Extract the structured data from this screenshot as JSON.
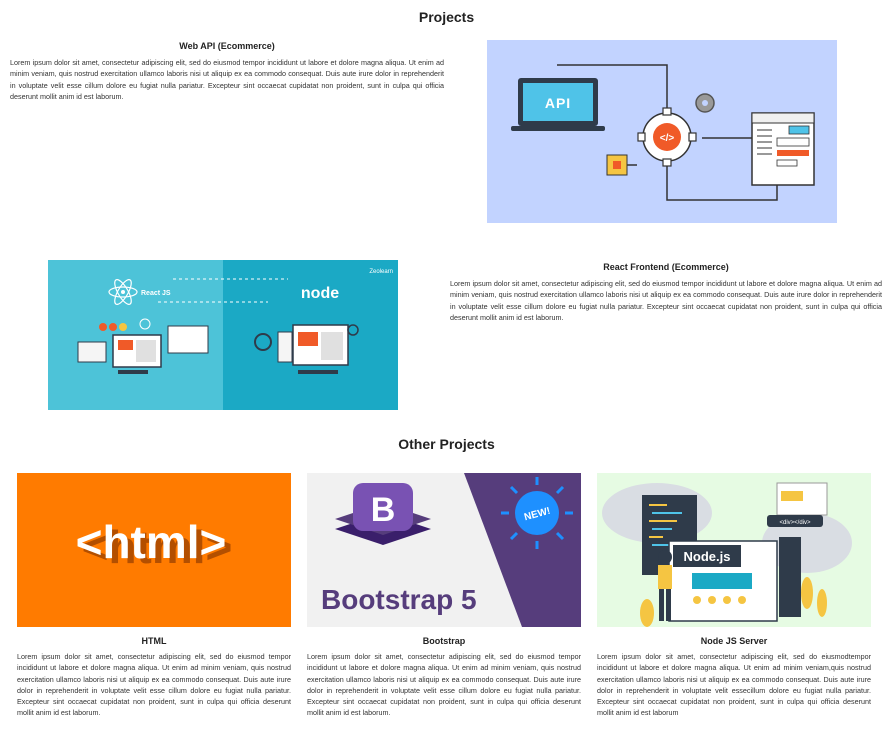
{
  "projects_section": {
    "title": "Projects",
    "items": [
      {
        "title": "Web API (Ecommerce)",
        "description": "Lorem ipsum dolor sit amet, consectetur adipiscing elit, sed do eiusmod tempor incididunt ut labore et dolore magna aliqua. Ut enim ad minim veniam, quis nostrud exercitation ullamco laboris nisi ut aliquip ex ea commodo consequat. Duis aute irure dolor in reprehenderit in voluptate velit esse cillum dolore eu fugiat nulla pariatur. Excepteur sint occaecat cupidatat non proident, sunt in culpa qui officia deserunt mollit anim id est laborum.",
        "image": {
          "icon": "api-illustration",
          "label": "API",
          "background": "#c2d3ff"
        }
      },
      {
        "title": "React Frontend (Ecommerce)",
        "description": "Lorem ipsum dolor sit amet, consectetur adipiscing elit, sed do eiusmod tempor incididunt ut labore et dolore magna aliqua. Ut enim ad minim veniam, quis nostrud exercitation ullamco laboris nisi ut aliquip ex ea commodo consequat. Duis aute irure dolor in reprehenderit in voluptate velit esse cillum dolore eu fugiat nulla pariatur. Excepteur sint occaecat cupidatat non proident, sunt in culpa qui officia deserunt mollit anim id est laborum.",
        "image": {
          "icon": "react-node-illustration",
          "react_label": "React JS",
          "node_label": "node",
          "brand": "Zeolearn",
          "background": "#4dc3d8"
        }
      }
    ]
  },
  "other_section": {
    "title": "Other Projects",
    "cards": [
      {
        "title": "HTML",
        "description": "Lorem ipsum dolor sit amet, consectetur adipiscing elit, sed do eiusmod tempor incididunt ut labore et dolore magna aliqua. Ut enim ad minim veniam, quis nostrud exercitation ullamco laboris nisi ut aliquip ex ea commodo consequat. Duis aute irure dolor in reprehenderit in voluptate velit esse cillum dolore eu fugiat nulla pariatur. Excepteur sint occaecat cupidatat non proident, sunt in culpa qui officia deserunt mollit anim id est laborum.",
        "image": {
          "icon": "html-logo",
          "label": "<html>",
          "background": "#ff7b00"
        }
      },
      {
        "title": "Bootstrap",
        "description": "Lorem ipsum dolor sit amet, consectetur adipiscing elit, sed do eiusmod tempor incididunt ut labore et dolore magna aliqua. Ut enim ad minim veniam, quis nostrud exercitation ullamco laboris nisi ut aliquip ex ea commodo consequat. Duis aute irure dolor in reprehenderit in voluptate velit esse cillum dolore eu fugiat nulla pariatur. Excepteur sint occaecat cupidatat non proident, sunt in culpa qui officia deserunt mollit anim id est laborum.",
        "image": {
          "icon": "bootstrap-logo",
          "label": "Bootstrap 5",
          "badge": "NEW!",
          "accent": "#563d7c"
        }
      },
      {
        "title": "Node JS Server",
        "description": "Lorem ipsum dolor sit amet, consectetur adipiscing elit, sed do eiusmodtempor incididunt ut labore et dolore magna aliqua. Ut enim ad minim veniam,quis nostrud exercitation ullamco laboris nisi ut aliquip ex ea commodo consequat. Duis aute irure dolor in reprehenderit in voluptate velit essecillum dolore eu fugiat nulla pariatur. Excepteur sint occaecat cupidatat non proident, sunt in culpa qui officia deserunt mollit anim id est laborum",
        "image": {
          "icon": "nodejs-illustration",
          "label": "Node.js",
          "tag": "<div></div>",
          "background": "#e6fbe3"
        }
      }
    ]
  }
}
